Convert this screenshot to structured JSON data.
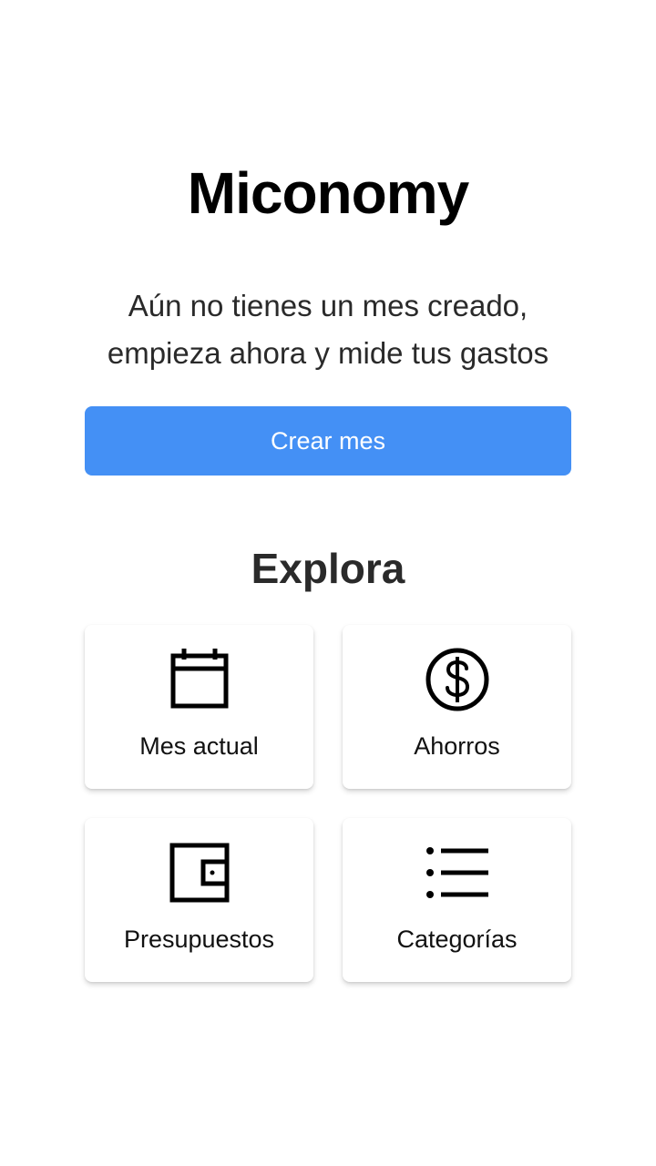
{
  "app": {
    "title": "Miconomy"
  },
  "empty_state": {
    "line1": "Aún no tienes un mes creado,",
    "line2": "empieza ahora y mide tus gastos",
    "button_label": "Crear mes"
  },
  "explore": {
    "title": "Explora",
    "cards": [
      {
        "label": "Mes actual",
        "icon": "calendar-icon"
      },
      {
        "label": "Ahorros",
        "icon": "dollar-circle-icon"
      },
      {
        "label": "Presupuestos",
        "icon": "wallet-icon"
      },
      {
        "label": "Categorías",
        "icon": "list-icon"
      }
    ]
  },
  "colors": {
    "primary": "#4490f5",
    "background": "#ffffff",
    "text": "#2a2a2a"
  }
}
